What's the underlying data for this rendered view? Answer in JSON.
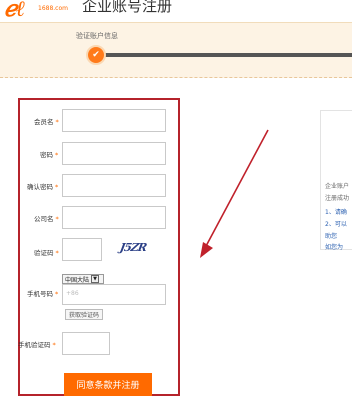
{
  "header": {
    "logo_text": "1688",
    "logo_domain": "1688.com",
    "title": "企业账号注册"
  },
  "progress": {
    "step_label": "验证账户信息",
    "step_icon": "check-icon"
  },
  "form": {
    "member_label": "会员名",
    "password_label": "密码",
    "confirm_password_label": "确认密码",
    "company_label": "公司名",
    "captcha_label": "验证码",
    "captcha_text": "J5ZR",
    "phone_label": "手机号码",
    "country_select": "中国大陆",
    "phone_placeholder": "+86",
    "sms_button": "获取验证码",
    "sms_code_label": "手机验证码",
    "required_mark": "*",
    "submit_label": "同意条款并注册"
  },
  "hint_panel": {
    "lines": [
      "企业账户",
      "注册成功",
      "1、请确",
      "2、可以",
      "助您",
      "如您为"
    ]
  },
  "colors": {
    "accent": "#ff6a00",
    "annotation": "#c0212b",
    "band": "#fdf3e4"
  }
}
